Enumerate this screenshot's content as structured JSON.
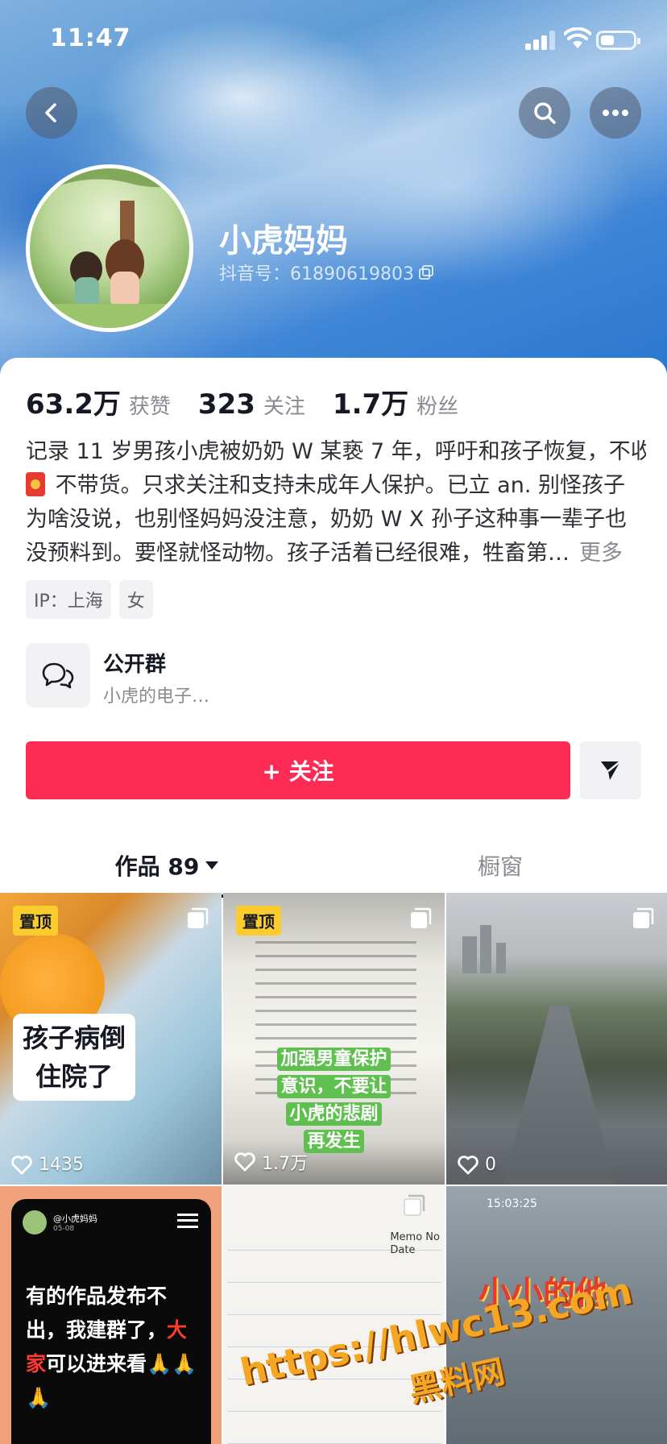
{
  "status_bar": {
    "time": "11:47"
  },
  "profile": {
    "nickname": "小虎妈妈",
    "douyin_id": "抖音号：61890619803"
  },
  "stats": [
    {
      "value": "63.2万",
      "label": "获赞"
    },
    {
      "value": "323",
      "label": "关注"
    },
    {
      "value": "1.7万",
      "label": "粉丝"
    }
  ],
  "bio": {
    "line1": "记录 11 岁男孩小虎被奶奶 W 某亵 7 年，呼吁和孩子恢复，不收",
    "line2": " 不带货。只求关注和支持未成年人保护。已立 an. 别怪孩子",
    "line3": "为啥没说，也别怪妈妈没注意，奶奶 W X 孙子这种事一辈子也",
    "line4": "没预料到。要怪就怪动物。孩子活着已经很难，牲畜第…",
    "more": "更多"
  },
  "tags": [
    "IP：上海",
    "女"
  ],
  "group": {
    "title": "公开群",
    "subtitle": "小虎的电子…"
  },
  "follow_button": "+ 关注",
  "tabs": {
    "works": "作品 89",
    "showcase": "橱窗"
  },
  "videos": [
    {
      "pinned": "置顶",
      "caption_line1": "孩子病倒",
      "caption_line2": "住院了",
      "likes": "1435"
    },
    {
      "pinned": "置顶",
      "caption_line1": "加强男童保护",
      "caption_line2": "意识，不要让",
      "caption_line3": "小虎的悲剧",
      "caption_line4": "再发生",
      "likes": "1.7万"
    },
    {
      "likes": "0"
    },
    {
      "handle": "@小虎妈妈",
      "date": "05-08",
      "text_a": "有的作品发布不出，我建群了，",
      "text_hl": "大家",
      "text_b": "可以进来看🙏🙏🙏"
    },
    {
      "memo": "Memo No",
      "memo2": "Date"
    },
    {
      "timestamp": "15:03:25",
      "title": "小小的他"
    }
  ],
  "watermark": {
    "line1": "https://hlwc13.com",
    "line2": "黑料网"
  },
  "colors": {
    "accent": "#fe2c55",
    "pin": "#facc2e"
  }
}
